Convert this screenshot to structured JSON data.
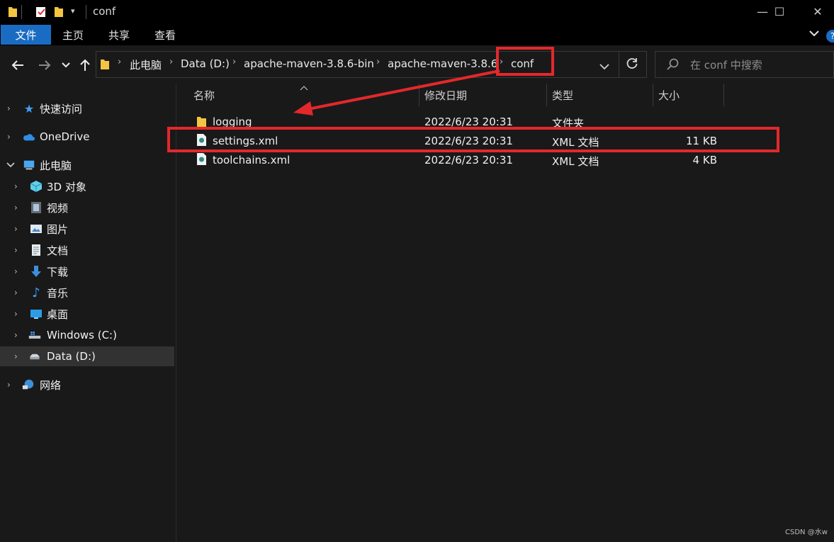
{
  "window": {
    "title": "conf",
    "minimize_glyph": "—",
    "maximize_glyph": "☐",
    "close_glyph": "✕"
  },
  "ribbon": {
    "tabs": [
      {
        "label": "文件",
        "active": true
      },
      {
        "label": "主页",
        "active": false
      },
      {
        "label": "共享",
        "active": false
      },
      {
        "label": "查看",
        "active": false
      }
    ],
    "help_glyph": "?"
  },
  "address": {
    "breadcrumbs": [
      "此电脑",
      "Data (D:)",
      "apache-maven-3.8.6-bin",
      "apache-maven-3.8.6",
      "conf"
    ]
  },
  "search": {
    "placeholder": "在 conf 中搜索"
  },
  "nav_pane": {
    "items": [
      {
        "label": "快速访问",
        "icon": "star-icon",
        "selected": false
      },
      {
        "label": "OneDrive",
        "icon": "cloud-icon",
        "selected": false
      },
      {
        "label": "此电脑",
        "icon": "computer-icon",
        "selected": false
      },
      {
        "label": "3D 对象",
        "icon": "cube-icon",
        "selected": false
      },
      {
        "label": "视频",
        "icon": "film-icon",
        "selected": false
      },
      {
        "label": "图片",
        "icon": "picture-icon",
        "selected": false
      },
      {
        "label": "文档",
        "icon": "document-icon",
        "selected": false
      },
      {
        "label": "下载",
        "icon": "download-icon",
        "selected": false
      },
      {
        "label": "音乐",
        "icon": "music-icon",
        "selected": false
      },
      {
        "label": "桌面",
        "icon": "desktop-icon",
        "selected": false
      },
      {
        "label": "Windows (C:)",
        "icon": "drive-icon",
        "selected": false
      },
      {
        "label": "Data (D:)",
        "icon": "drive-icon",
        "selected": true
      },
      {
        "label": "网络",
        "icon": "network-icon",
        "selected": false
      }
    ]
  },
  "file_list": {
    "columns": [
      "名称",
      "修改日期",
      "类型",
      "大小"
    ],
    "rows": [
      {
        "name": "logging",
        "date": "2022/6/23 20:31",
        "type": "文件夹",
        "size": "",
        "icon": "folder-icon"
      },
      {
        "name": "settings.xml",
        "date": "2022/6/23 20:31",
        "type": "XML 文档",
        "size": "11 KB",
        "icon": "xml-file-icon"
      },
      {
        "name": "toolchains.xml",
        "date": "2022/6/23 20:31",
        "type": "XML 文档",
        "size": "4 KB",
        "icon": "xml-file-icon"
      }
    ]
  },
  "annotations": {
    "highlight_color": "#e3282b"
  },
  "watermark": "CSDN @水w",
  "colors": {
    "accent": "#1a6cc2",
    "background": "#191919",
    "folder": "#f4c542",
    "annotation": "#e3282b"
  }
}
